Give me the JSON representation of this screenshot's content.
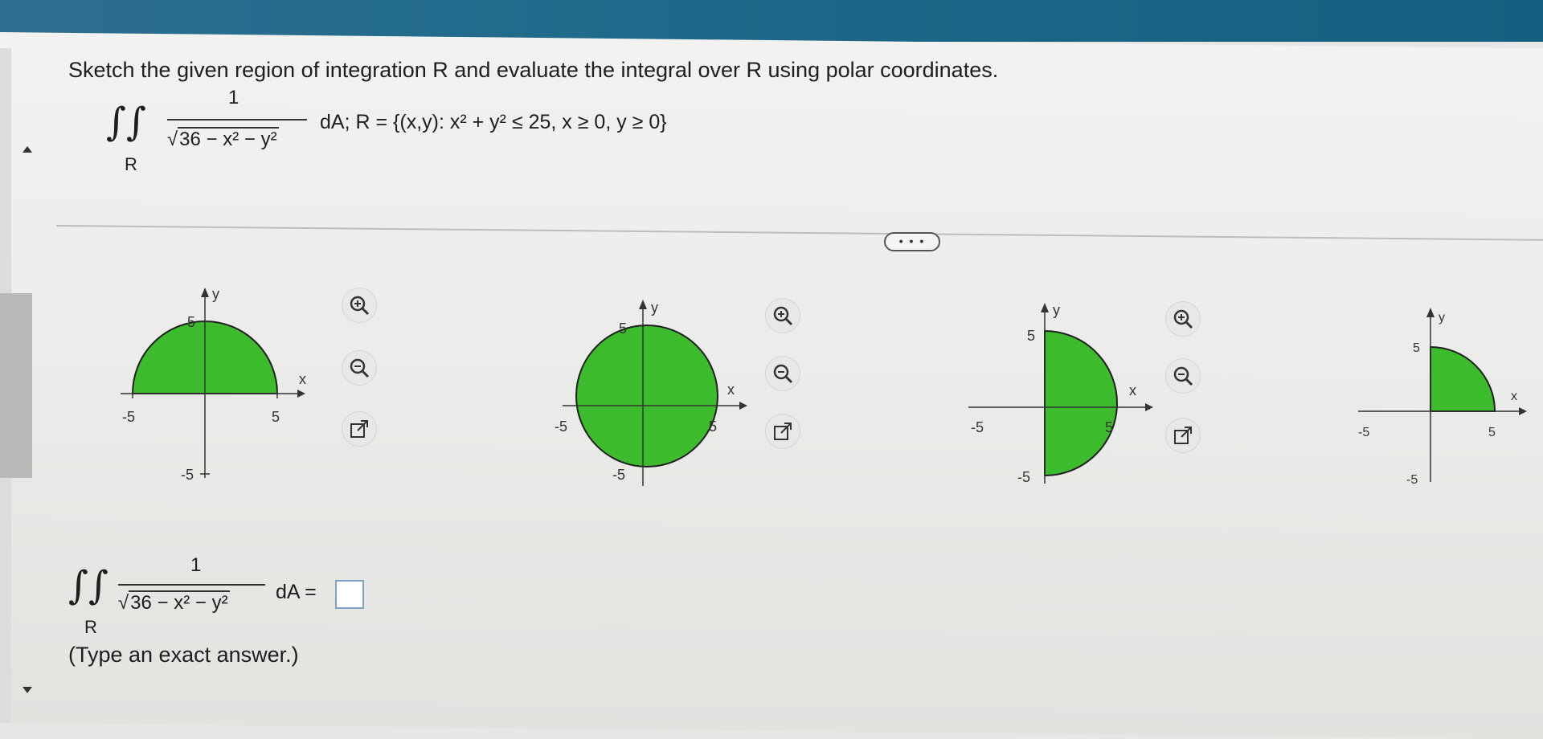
{
  "question": {
    "prompt": "Sketch the given region of integration R and evaluate the integral over R using polar coordinates.",
    "integrand_numerator": "1",
    "integrand_denominator": "36 − x² − y²",
    "integral_sub": "R",
    "region_text": "dA; R = {(x,y): x² + y² ≤ 25, x ≥ 0, y ≥ 0}"
  },
  "more_button": "• • •",
  "graphs": [
    {
      "region": "upper-half-disk",
      "y_label": "y",
      "x_label": "x",
      "tick_neg_x": "-5",
      "tick_pos_x": "5",
      "tick_pos_y": "5",
      "tick_neg_y": "-5"
    },
    {
      "region": "full-disk",
      "y_label": "y",
      "x_label": "x",
      "tick_neg_x": "-5",
      "tick_pos_x": "5",
      "tick_pos_y": "5",
      "tick_neg_y": "-5"
    },
    {
      "region": "right-half-disk",
      "y_label": "y",
      "x_label": "x",
      "tick_neg_x": "-5",
      "tick_pos_x": "5",
      "tick_pos_y": "5",
      "tick_neg_y": "-5"
    },
    {
      "region": "first-quadrant",
      "y_label": "y",
      "x_label": "x",
      "tick_neg_x": "-5",
      "tick_pos_x": "5",
      "tick_pos_y": "5",
      "tick_neg_y": "-5"
    }
  ],
  "tools": [
    "zoom-in-icon",
    "zoom-out-icon",
    "open-external-icon"
  ],
  "answer": {
    "integrand_numerator": "1",
    "integrand_denominator": "36 − x² − y²",
    "integral_sub": "R",
    "suffix": "dA =",
    "value": "",
    "hint": "(Type an exact answer.)"
  },
  "colors": {
    "region_fill": "#3cbc2c",
    "region_stroke": "#1f1f1f",
    "topbar": "#1f6a8a"
  }
}
